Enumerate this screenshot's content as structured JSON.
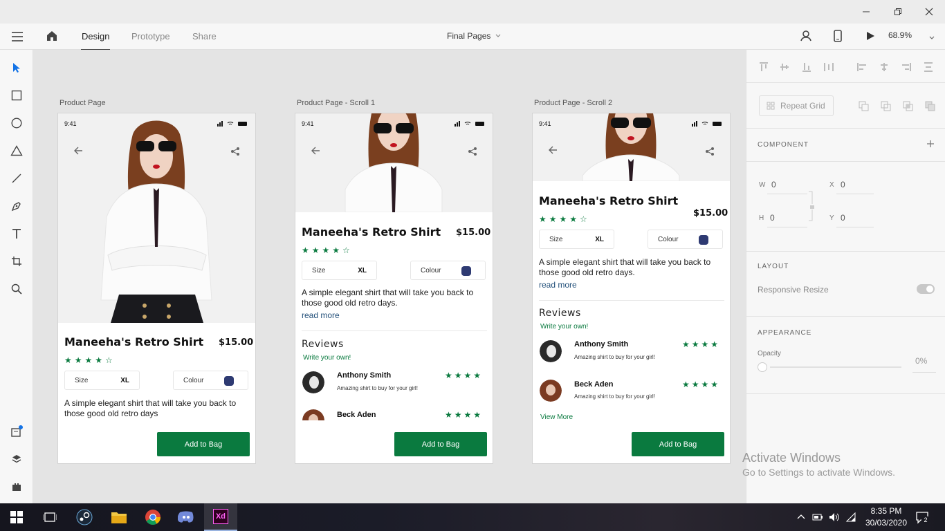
{
  "window": {
    "minimize_icon": "minimize-icon",
    "restore_icon": "restore-icon",
    "close_icon": "close-icon"
  },
  "appbar": {
    "tabs": [
      {
        "label": "Design",
        "active": true
      },
      {
        "label": "Prototype",
        "active": false
      },
      {
        "label": "Share",
        "active": false
      }
    ],
    "document": "Final Pages",
    "zoom": "68.9%"
  },
  "toolbar": {
    "tools": [
      "select",
      "rectangle",
      "ellipse",
      "polygon",
      "line",
      "pen",
      "text",
      "artboard",
      "zoom"
    ],
    "bottom": [
      "assets",
      "layers",
      "plugins"
    ]
  },
  "artboards": [
    {
      "label": "Product Page"
    },
    {
      "label": "Product Page - Scroll 1"
    },
    {
      "label": "Product Page - Scroll 2"
    }
  ],
  "product": {
    "time": "9:41",
    "title": "Maneeha's Retro Shirt",
    "price": "$15.00",
    "rating": 4,
    "stars": "★★★★☆",
    "size_label": "Size",
    "size_value": "XL",
    "colour_label": "Colour",
    "colour_value": "#2e3a72",
    "description_short": "A simple elegant shirt that will take you back to those good old retro days",
    "description": "A simple elegant shirt that will take you back to those good old retro days.",
    "read_more": "read more",
    "reviews_heading": "Reviews",
    "write_review": "Write your own!",
    "reviews": [
      {
        "name": "Anthony Smith",
        "text": "Amazing shirt to buy for your girl!",
        "stars": "★★★★"
      },
      {
        "name": "Beck Aden",
        "text": "Amazing shirt to buy for your girl!",
        "stars": "★★★★"
      }
    ],
    "view_more": "View More",
    "add_to_bag": "Add to Bag"
  },
  "panel": {
    "repeat_grid": "Repeat Grid",
    "component": "COMPONENT",
    "w_label": "W",
    "w_value": "0",
    "x_label": "X",
    "x_value": "0",
    "h_label": "H",
    "h_value": "0",
    "y_label": "Y",
    "y_value": "0",
    "layout": "LAYOUT",
    "responsive_resize": "Responsive Resize",
    "appearance": "APPEARANCE",
    "opacity_label": "Opacity",
    "opacity_value": "0%"
  },
  "watermark": {
    "title": "Activate Windows",
    "subtitle": "Go to Settings to activate Windows."
  },
  "taskbar": {
    "time": "8:35 PM",
    "date": "30/03/2020",
    "notifications": "2",
    "active_app": "Xd"
  },
  "colors": {
    "accent": "#0a7a3f",
    "swatch": "#2e3a72",
    "select_blue": "#1473e6"
  }
}
